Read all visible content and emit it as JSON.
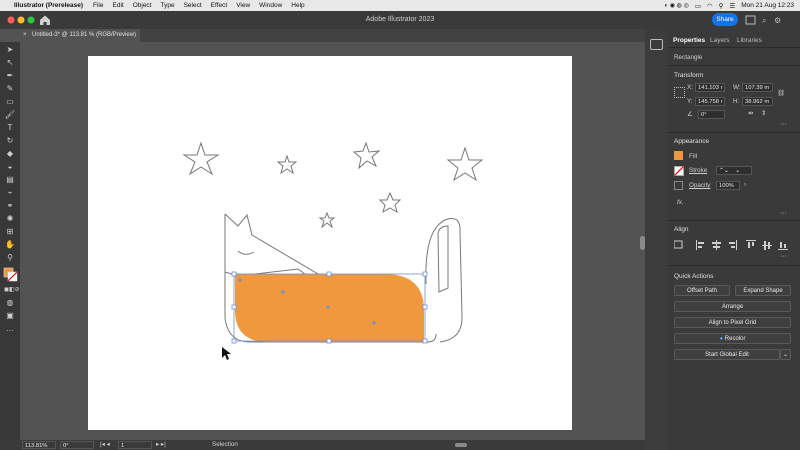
{
  "menubar": {
    "app": "Illustrator (Prerelease)",
    "items": [
      "File",
      "Edit",
      "Object",
      "Type",
      "Select",
      "Effect",
      "View",
      "Window",
      "Help"
    ],
    "clock": "Mon 21 Aug 12:23"
  },
  "window": {
    "title": "Adobe Illustrator 2023",
    "share_label": "Share"
  },
  "document": {
    "tab_title": "Untitled-3* @ 113.81 % (RGB/Preview)"
  },
  "panel": {
    "tabs": [
      "Properties",
      "Layers",
      "Libraries"
    ],
    "object_type": "Rectangle",
    "transform": {
      "header": "Transform",
      "x_label": "X:",
      "x": "141.103 r",
      "y_label": "Y:",
      "y": "145.758 r",
      "w_label": "W:",
      "w": "107.39 m",
      "h_label": "H:",
      "h": "38.962 m",
      "angle": "0°"
    },
    "appearance": {
      "header": "Appearance",
      "fill_label": "Fill",
      "stroke_label": "Stroke",
      "opacity_label": "Opacity",
      "opacity": "100%",
      "fill_color": "#f0983d",
      "fx_label": "fx."
    },
    "align": {
      "header": "Align"
    },
    "quick_actions": {
      "header": "Quick Actions",
      "offset_path": "Offset Path",
      "expand_shape": "Expand Shape",
      "arrange": "Arrange",
      "align_pixel": "Align to Pixel Grid",
      "recolor": "Recolor",
      "global_edit": "Start Global Edit"
    }
  },
  "status": {
    "zoom": "113.81%",
    "rotation": "0°",
    "artboard": "1",
    "mode": "Selection"
  },
  "icons": [
    "apple-icon",
    "home-icon",
    "selection-tool-icon",
    "direct-selection-tool-icon",
    "pen-tool-icon",
    "type-tool-icon",
    "rectangle-tool-icon",
    "paintbrush-tool-icon",
    "rotate-tool-icon",
    "zoom-tool-icon",
    "hand-tool-icon",
    "wifi-icon",
    "search-icon",
    "battery-icon"
  ]
}
